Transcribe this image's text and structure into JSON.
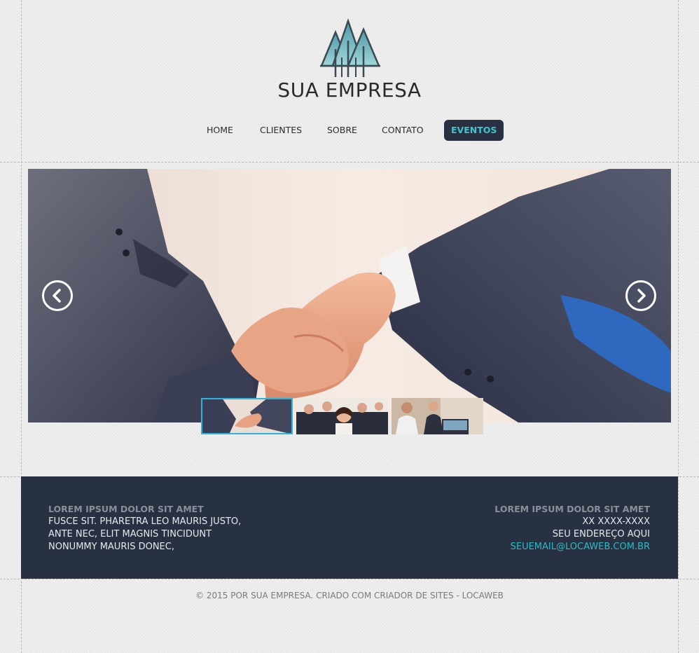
{
  "brand": {
    "name": "SUA EMPRESA",
    "logo_icon": "trees-icon",
    "logo_color": "#5aa9b4"
  },
  "nav": {
    "items": [
      {
        "label": "HOME"
      },
      {
        "label": "CLIENTES"
      },
      {
        "label": "SOBRE"
      },
      {
        "label": "CONTATO"
      },
      {
        "label": "EVENTOS",
        "active": true
      }
    ],
    "active_bg": "#283141",
    "active_color": "#3ec6d0"
  },
  "slider": {
    "prev_icon": "chevron-left-icon",
    "next_icon": "chevron-right-icon",
    "active_index": 0,
    "slides": [
      "handshake",
      "business-team",
      "office-meeting"
    ]
  },
  "footer": {
    "left": {
      "heading": "LOREM IPSUM DOLOR SIT AMET",
      "lines": [
        "FUSCE SIT. PHARETRA LEO MAURIS JUSTO,",
        "ANTE NEC, ELIT MAGNIS TINCIDUNT",
        "NONUMMY MAURIS DONEC,"
      ]
    },
    "right": {
      "heading": "LOREM IPSUM DOLOR SIT AMET",
      "phone": "XX XXXX-XXXX",
      "address": "SEU ENDEREÇO AQUI",
      "email": "SEUEMAIL@LOCAWEB.COM.BR"
    },
    "bg": "#283141",
    "link_color": "#2fb9c4"
  },
  "copyright": "© 2015 POR SUA EMPRESA. CRIADO COM CRIADOR DE SITES - LOCAWEB"
}
